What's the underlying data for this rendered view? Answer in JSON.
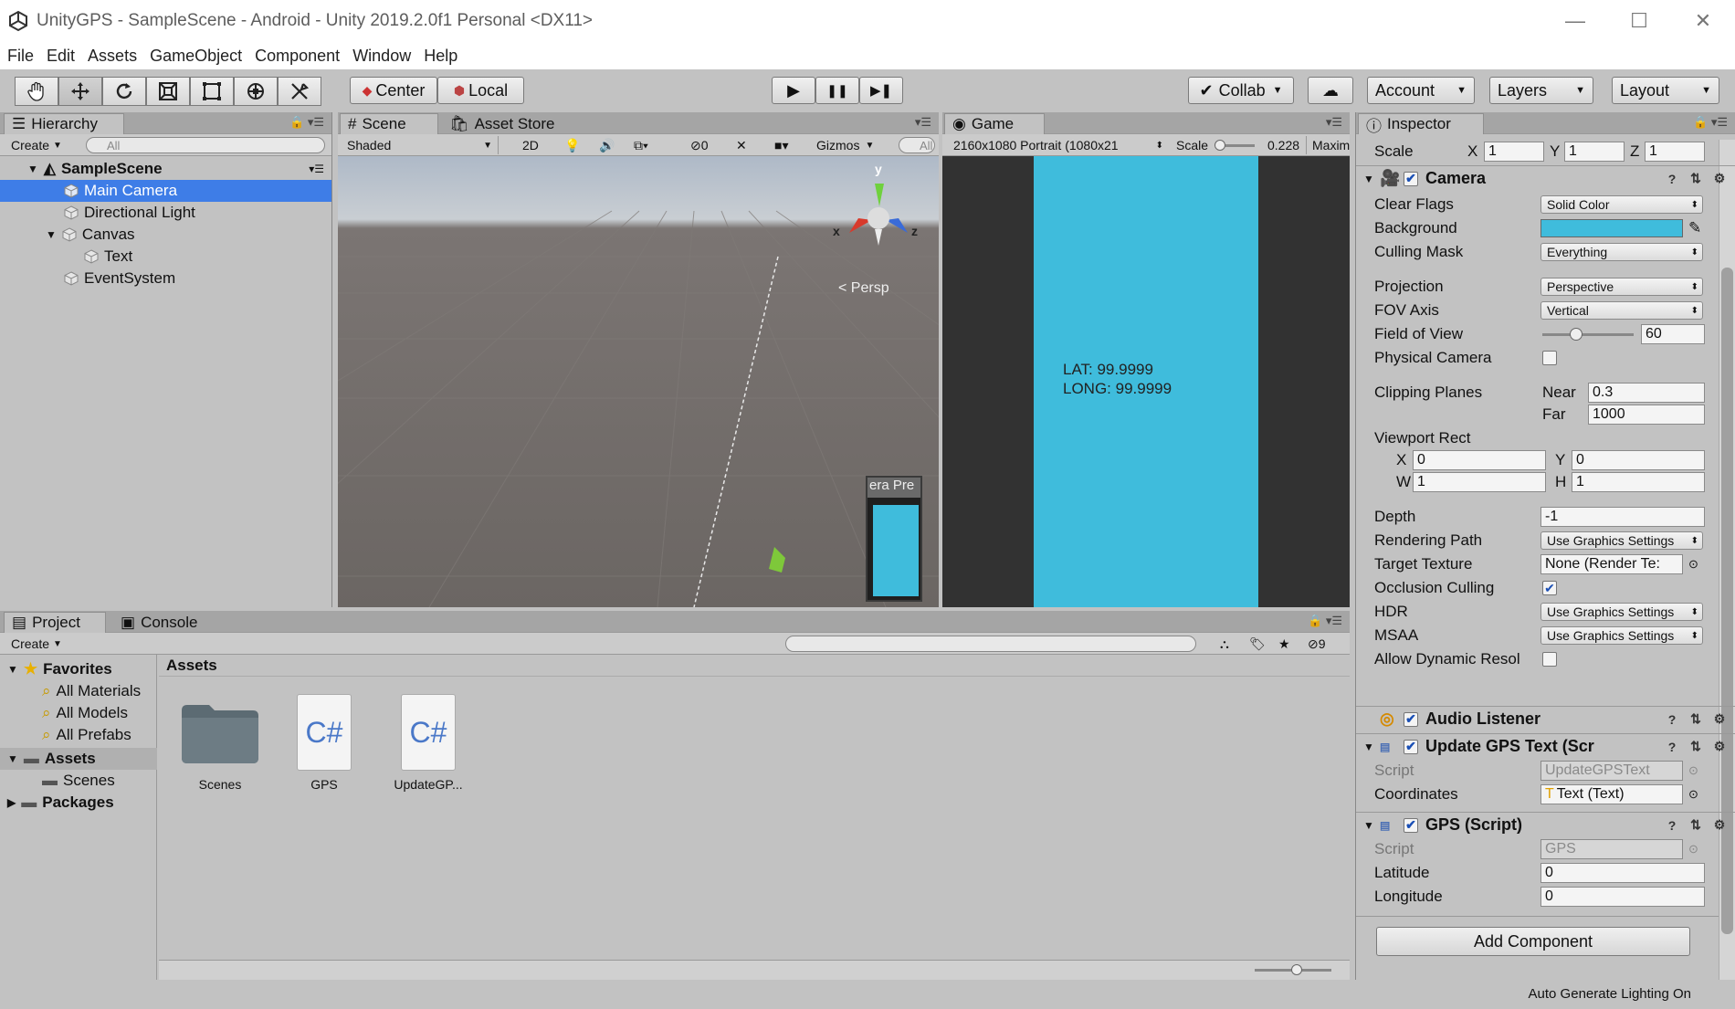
{
  "window": {
    "title": "UnityGPS - SampleScene - Android - Unity 2019.2.0f1 Personal <DX11>",
    "controls": [
      "—",
      "☐",
      "✕"
    ]
  },
  "menu": [
    "File",
    "Edit",
    "Assets",
    "GameObject",
    "Component",
    "Window",
    "Help"
  ],
  "toolbar": {
    "tools": [
      "hand-tool-icon",
      "move-tool-icon",
      "rotate-tool-icon",
      "scale-tool-icon",
      "rect-tool-icon",
      "transform-tool-icon",
      "custom-tool-icon"
    ],
    "pivot_center": "Center",
    "pivot_local": "Local",
    "play": "▶",
    "pause": "❚❚",
    "step": "▶❚",
    "collab": "Collab",
    "account": "Account",
    "layers": "Layers",
    "layout": "Layout"
  },
  "hierarchy": {
    "tab": "Hierarchy",
    "create": "Create",
    "search_placeholder": "All",
    "scene": "SampleScene",
    "items": [
      {
        "label": "Main Camera",
        "indent": 1,
        "selected": true
      },
      {
        "label": "Directional Light",
        "indent": 1
      },
      {
        "label": "Canvas",
        "indent": 1,
        "expanded": true
      },
      {
        "label": "Text",
        "indent": 2
      },
      {
        "label": "EventSystem",
        "indent": 1
      }
    ]
  },
  "scene": {
    "tab_scene": "Scene",
    "tab_store": "Asset Store",
    "shading": "Shaded",
    "mode_2d": "2D",
    "hidden_count": "0",
    "gizmos": "Gizmos",
    "search_placeholder": "All",
    "persp": "< Persp",
    "axis_y": "y",
    "axis_x": "x",
    "axis_z": "z",
    "camera_preview": "era Pre"
  },
  "game": {
    "tab": "Game",
    "resolution": "2160x1080 Portrait (1080x21",
    "scale_label": "Scale",
    "scale_value": "0.228",
    "maximize": "Maxim",
    "lat": "LAT: 99.9999",
    "long": "LONG: 99.9999",
    "background_color": "#3fbcdc"
  },
  "inspector": {
    "tab": "Inspector",
    "scale_label": "Scale",
    "scale": {
      "x": "1",
      "y": "1",
      "z": "1"
    },
    "camera": {
      "title": "Camera",
      "clear_flags_label": "Clear Flags",
      "clear_flags": "Solid Color",
      "background_label": "Background",
      "culling_label": "Culling Mask",
      "culling": "Everything",
      "projection_label": "Projection",
      "projection": "Perspective",
      "fov_axis_label": "FOV Axis",
      "fov_axis": "Vertical",
      "fov_label": "Field of View",
      "fov": "60",
      "physical_label": "Physical Camera",
      "clipping_label": "Clipping Planes",
      "near_label": "Near",
      "near": "0.3",
      "far_label": "Far",
      "far": "1000",
      "viewport_label": "Viewport Rect",
      "vx": "0",
      "vy": "0",
      "vw": "1",
      "vh": "1",
      "depth_label": "Depth",
      "depth": "-1",
      "rendering_label": "Rendering Path",
      "rendering": "Use Graphics Settings",
      "target_label": "Target Texture",
      "target": "None (Render Te:",
      "occlusion_label": "Occlusion Culling",
      "hdr_label": "HDR",
      "hdr": "Use Graphics Settings",
      "msaa_label": "MSAA",
      "msaa": "Use Graphics Settings",
      "dynres_label": "Allow Dynamic Resol"
    },
    "audio": {
      "title": "Audio Listener"
    },
    "update_gps": {
      "title": "Update GPS Text (Scr",
      "script_label": "Script",
      "script": "UpdateGPSText",
      "coords_label": "Coordinates",
      "coords": "Text (Text)"
    },
    "gps": {
      "title": "GPS (Script)",
      "script_label": "Script",
      "script": "GPS",
      "lat_label": "Latitude",
      "lat": "0",
      "long_label": "Longitude",
      "long": "0"
    },
    "add_component": "Add Component"
  },
  "project": {
    "tab_project": "Project",
    "tab_console": "Console",
    "create": "Create",
    "hidden_count": "9",
    "favorites": "Favorites",
    "fav_items": [
      "All Materials",
      "All Models",
      "All Prefabs"
    ],
    "assets": "Assets",
    "scenes": "Scenes",
    "packages": "Packages",
    "breadcrumb": "Assets",
    "files": [
      {
        "name": "Scenes",
        "kind": "folder"
      },
      {
        "name": "GPS",
        "kind": "script"
      },
      {
        "name": "UpdateGP...",
        "kind": "script"
      }
    ],
    "script_glyph": "C#"
  },
  "status": {
    "text": "Auto Generate Lighting On"
  }
}
